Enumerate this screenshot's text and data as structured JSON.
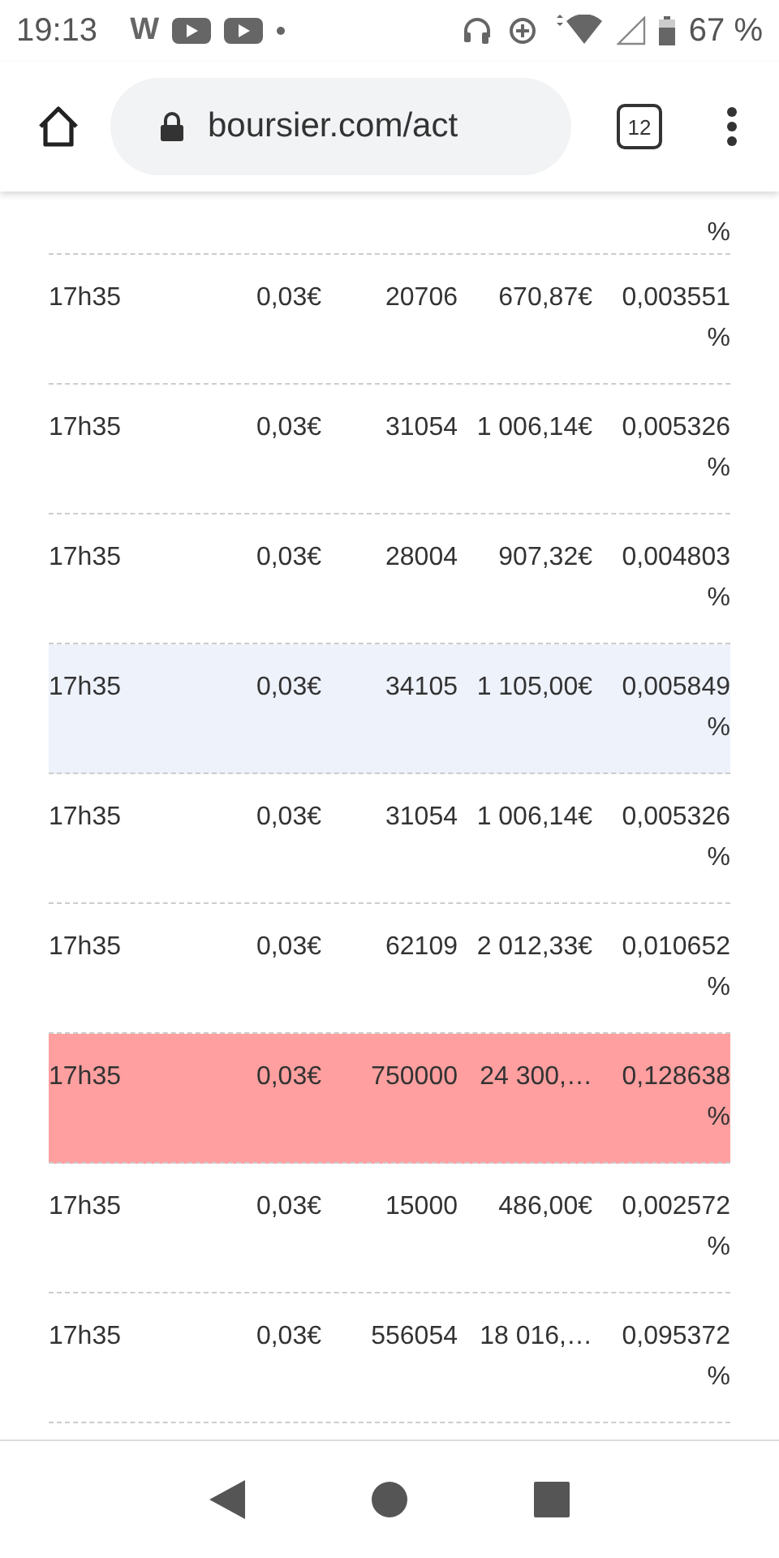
{
  "status_bar": {
    "time": "19:13",
    "app_letter": "W",
    "battery": "67 %"
  },
  "browser": {
    "url": "boursier.com/act",
    "tab_count": "12"
  },
  "table": {
    "top_fragment": "%",
    "rows": [
      {
        "cells": [
          "17h35",
          "0,03€",
          "20706",
          "670,87€",
          "0,003551 %"
        ]
      },
      {
        "cells": [
          "17h35",
          "0,03€",
          "31054",
          "1 006,14€",
          "0,005326 %"
        ]
      },
      {
        "cells": [
          "17h35",
          "0,03€",
          "28004",
          "907,32€",
          "0,004803 %"
        ]
      },
      {
        "cells": [
          "17h35",
          "0,03€",
          "34105",
          "1 105,00€",
          "0,005849 %"
        ],
        "color": "#eef2fb"
      },
      {
        "cells": [
          "17h35",
          "0,03€",
          "31054",
          "1 006,14€",
          "0,005326 %"
        ]
      },
      {
        "cells": [
          "17h35",
          "0,03€",
          "62109",
          "2 012,33€",
          "0,010652 %"
        ]
      },
      {
        "cells": [
          "17h35",
          "0,03€",
          "750000",
          "24 300,…",
          "0,128638 %"
        ],
        "color": "#ff9f9f"
      },
      {
        "cells": [
          "17h35",
          "0,03€",
          "15000",
          "486,00€",
          "0,002572 %"
        ]
      },
      {
        "cells": [
          "17h35",
          "0,03€",
          "556054",
          "18 016,…",
          "0,095372 %"
        ]
      }
    ]
  }
}
